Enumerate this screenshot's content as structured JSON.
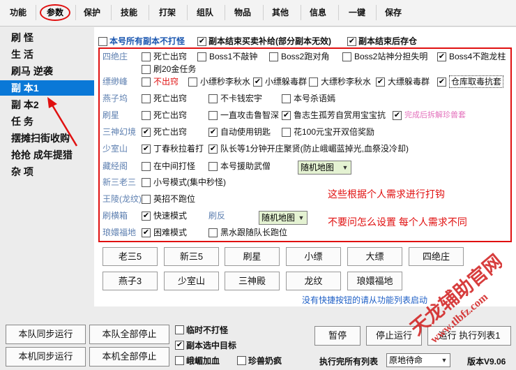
{
  "tabs": [
    "功能",
    "参数",
    "保护",
    "技能",
    "打架",
    "组队",
    "物品",
    "其他",
    "信息",
    "一键",
    "保存"
  ],
  "nav": [
    "刷 怪",
    "生 活",
    "刷马 逆袭",
    "副 本1",
    "副 本2",
    "任 务",
    "摆摊扫街收购",
    "抢抢 成年提猎",
    "杂 项"
  ],
  "top_row": {
    "a": "本号所有副本不打怪",
    "b": "副本结束买卖补给(部分副本无效)",
    "c": "副本结束后存仓"
  },
  "rows": [
    {
      "cat": "四绝庄",
      "items": [
        "死亡出窍",
        "Boss1不敲钟",
        "Boss2跑对角",
        "Boss2站神分担失明",
        "Boss4不跑龙柱"
      ]
    },
    {
      "cat": "",
      "items": [
        "刷20金任务"
      ]
    },
    {
      "cat": "缥缈峰",
      "items": [
        "不出窍",
        "小缥秒李秋水",
        "小缥躲毒群",
        "大缥秒李秋水",
        "大缥躲毒群",
        "仓库取毒抗套"
      ]
    },
    {
      "cat": "燕子坞",
      "items": [
        "死亡出窍",
        "不卡钱宏宇",
        "本号杀语嫣"
      ]
    },
    {
      "cat": "刷星",
      "items": [
        "死亡出窍",
        "一直攻击鲁智深",
        "鲁志生孤芳自赏用宝宝抗",
        "完成后拆解珍兽套"
      ]
    },
    {
      "cat": "三神幻境",
      "items": [
        "死亡出窍",
        "自动使用钥匙",
        "花100元宝开双倍奖励"
      ]
    },
    {
      "cat": "少室山",
      "items": [
        "丁春秋拉着打",
        "队长等1分钟开庄聚贤(防止峨嵋蓝掉光,血祭没冷却)"
      ]
    },
    {
      "cat": "藏经阁",
      "items": [
        "在中间打怪",
        "本号援助武僧"
      ]
    },
    {
      "cat": "新三老三",
      "items": [
        "小号模式(集中秒怪)"
      ]
    },
    {
      "cat": "王陵(龙纹)",
      "items": [
        "英招不跑位"
      ]
    },
    {
      "cat": "刷横箱",
      "items": [
        "快速模式",
        "刷反"
      ]
    },
    {
      "cat": "琅嬛福地",
      "items": [
        "困难模式",
        "黑水跟随队长跑位"
      ]
    }
  ],
  "selects": {
    "cangjing": "随机地图",
    "shuafan": "随机地图",
    "finish": "原地待命"
  },
  "notes": [
    "这些根据个人需求进行打钩",
    "不要问怎么设置  每个人需求不同"
  ],
  "quick_buttons": [
    "老三5",
    "新三5",
    "刷星",
    "小缥",
    "大缥",
    "四绝庄",
    "燕子3",
    "少室山",
    "三神殿",
    "龙纹",
    "琅嬛福地"
  ],
  "hint": "没有快捷按钮的请从功能列表启动",
  "bottom": {
    "team_sync": "本队同步运行",
    "team_stop": "本队全部停止",
    "local_sync": "本机同步运行",
    "local_stop": "本机全部停止",
    "cb_temp": "临时不打怪",
    "cb_target": "副本选中目标",
    "cb_emei": "峨嵋加血",
    "cb_pet": "珍兽奶疯",
    "pause": "暂停",
    "stop_run": "停止运行",
    "run_list": "运行 执行列表1",
    "finish_label": "执行完所有列表",
    "version": "版本V9.06"
  },
  "watermark": "天龙辅助官网 www.tlbfz.com",
  "colors": {
    "accent": "#0a78d7",
    "annotation": "#e01010",
    "category": "#5d7fb0"
  }
}
